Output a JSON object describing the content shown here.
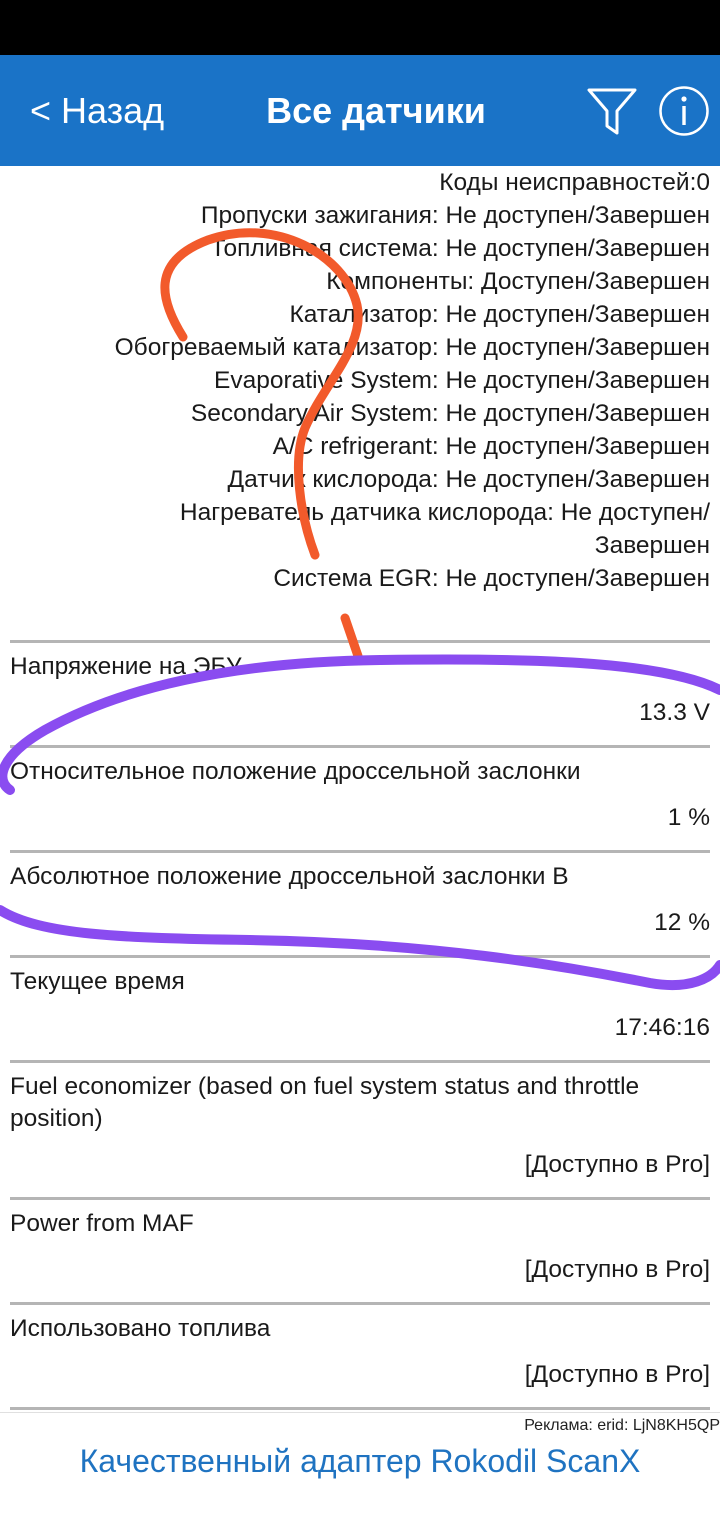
{
  "nav": {
    "back_label": "< Назад",
    "title": "Все датчики",
    "bg_color": "#1a73c7",
    "filter_icon": "funnel-icon",
    "info_icon": "info-icon"
  },
  "status_lines": [
    "Коды неисправностей:0",
    "Пропуски зажигания: Не доступен/Завершен",
    "Топливная система: Не доступен/Завершен",
    "Компоненты: Доступен/Завершен",
    "Катализатор: Не доступен/Завершен",
    "Обогреваемый катализатор: Не доступен/Завершен",
    "Evaporative System: Не доступен/Завершен",
    "Secondary Air System: Не доступен/Завершен",
    "A/C refrigerant: Не доступен/Завершен",
    "Датчик кислорода: Не доступен/Завершен",
    "Нагреватель датчика кислорода: Не доступен/ Завершен",
    "Система EGR: Не доступен/Завершен"
  ],
  "sensors": [
    {
      "label": "Напряжение на ЭБУ",
      "value": "13.3 V"
    },
    {
      "label": "Относительное положение дроссельной заслонки",
      "value": "1 %"
    },
    {
      "label": "Абсолютное положение дроссельной заслонки B",
      "value": "12 %"
    },
    {
      "label": "Текущее время",
      "value": "17:46:16"
    },
    {
      "label": "Fuel economizer (based on fuel system status and throttle position)",
      "value": "[Доступно в Pro]"
    },
    {
      "label": "Power from MAF",
      "value": "[Доступно в Pro]"
    },
    {
      "label": "Использовано топлива",
      "value": "[Доступно в Pro]"
    }
  ],
  "ad": {
    "label": "Реклама: erid: LjN8KH5QP",
    "link_text": "Качественный адаптер Rokodil ScanX",
    "link_color": "#1f73c1"
  },
  "annotations": {
    "question_mark_color": "#f25a2b",
    "ellipse_color": "#8a4cf0"
  }
}
